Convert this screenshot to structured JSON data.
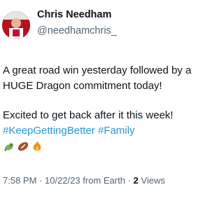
{
  "tweet": {
    "display_name": "Chris Needham",
    "handle": "@needhamchris_",
    "text_lines": [
      "A great road win yesterday followed by a",
      "HUGE Dragon commitment today!"
    ],
    "text_line_3": "Excited to get back after it this week!",
    "hashtags": [
      "#KeepGettingBetter",
      "#Family"
    ],
    "emojis": [
      "dragon-icon",
      "football-icon",
      "fire-icon"
    ],
    "time": "7:58 PM",
    "date": "10/22/23",
    "source": "from Earth",
    "separator": "·",
    "views_count": "2",
    "views_label": "Views"
  }
}
